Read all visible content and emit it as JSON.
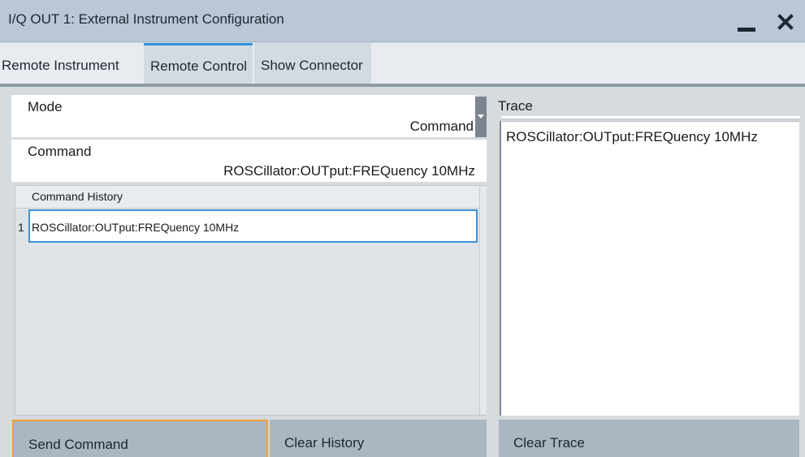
{
  "window": {
    "title": "I/Q OUT 1: External Instrument Configuration",
    "minimize_icon": "minimize-icon",
    "close_icon": "close-icon"
  },
  "tabs": [
    {
      "label": "Remote Instrument",
      "active": false
    },
    {
      "label": "Remote Control",
      "active": true
    },
    {
      "label": "Show Connector",
      "active": false
    }
  ],
  "mode": {
    "label": "Mode",
    "value": "Command"
  },
  "command": {
    "label": "Command",
    "value": "ROSCillator:OUTput:FREQuency 10MHz"
  },
  "history": {
    "header": "Command History",
    "rows": [
      {
        "index": "1",
        "text": "ROSCillator:OUTput:FREQuency 10MHz"
      }
    ]
  },
  "trace": {
    "label": "Trace",
    "text": "ROSCillator:OUTput:FREQuency 10MHz"
  },
  "buttons": {
    "send": "Send Command",
    "clear_history": "Clear History",
    "clear_trace": "Clear Trace"
  },
  "colors": {
    "titlebar": "#b9c7d6",
    "active_tab_accent": "#2f8fe0",
    "focus_border": "#f0a030",
    "selection_border": "#3f93d8"
  }
}
